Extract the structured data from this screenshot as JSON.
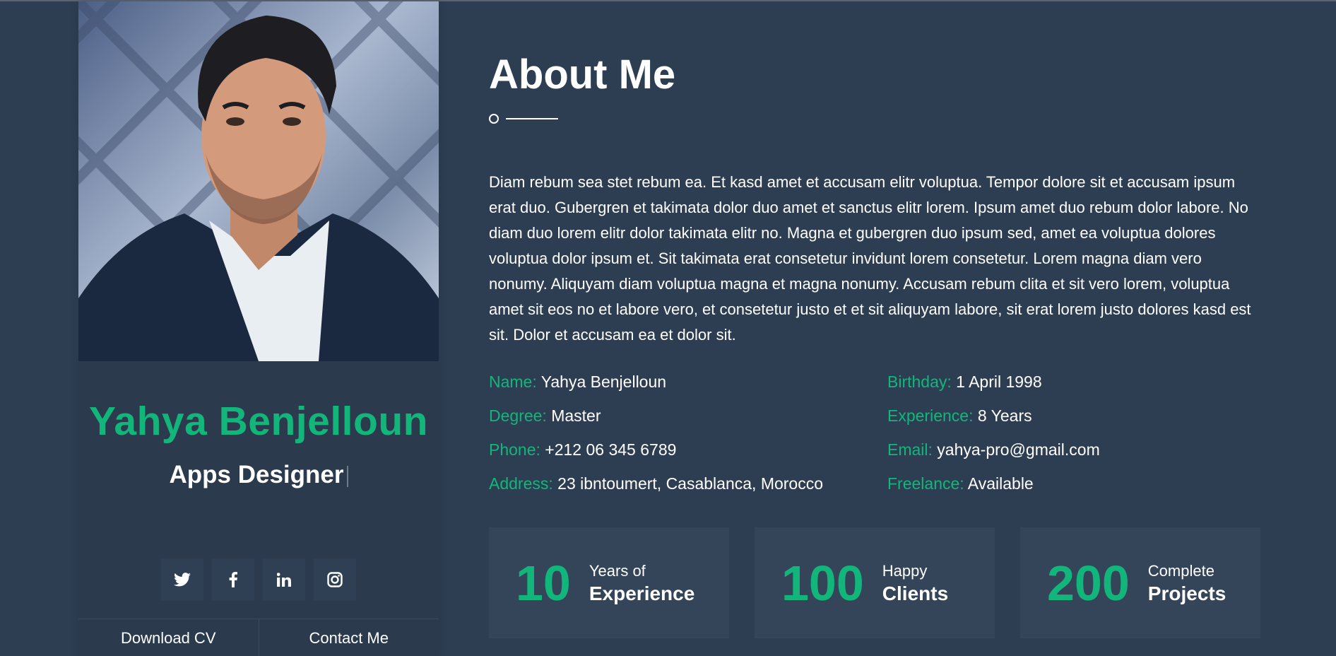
{
  "colors": {
    "background": "#2e3e52",
    "accent": "#12b67a",
    "panel": "#2b3a4d",
    "card": "#354559"
  },
  "profile": {
    "name": "Yahya Benjelloun",
    "role": "Apps Designer",
    "socials": [
      {
        "icon": "twitter-icon",
        "glyph": "🐦"
      },
      {
        "icon": "facebook-icon",
        "glyph": "f"
      },
      {
        "icon": "linkedin-icon",
        "glyph": "in"
      },
      {
        "icon": "instagram-icon",
        "glyph": "◎"
      }
    ],
    "download_cv": "Download CV",
    "contact_me": "Contact Me"
  },
  "about": {
    "title": "About Me",
    "bio": "Diam rebum sea stet rebum ea. Et kasd amet et accusam elitr voluptua. Tempor dolore sit et accusam ipsum erat duo. Gubergren et takimata dolor duo amet et sanctus elitr lorem. Ipsum amet duo rebum dolor labore. No diam duo lorem elitr dolor takimata elitr no. Magna et gubergren duo ipsum sed, amet ea voluptua dolores voluptua dolor ipsum et. Sit takimata erat consetetur invidunt lorem consetetur. Lorem magna diam vero nonumy. Aliquyam diam voluptua magna et magna nonumy. Accusam rebum clita et sit vero lorem, voluptua amet sit eos no et labore vero, et consetetur justo et et sit aliquyam labore, sit erat lorem justo dolores kasd est sit. Dolor et accusam ea et dolor sit.",
    "info": {
      "name_label": "Name:",
      "name_value": "Yahya Benjelloun",
      "birthday_label": "Birthday:",
      "birthday_value": "1 April 1998",
      "degree_label": "Degree:",
      "degree_value": "Master",
      "experience_label": "Experience:",
      "experience_value": "8 Years",
      "phone_label": "Phone:",
      "phone_value": "+212 06 345 6789",
      "email_label": "Email:",
      "email_value": "yahya-pro@gmail.com",
      "address_label": "Address:",
      "address_value": "23 ibntoumert, Casablanca, Morocco",
      "freelance_label": "Freelance:",
      "freelance_value": "Available"
    },
    "stats": [
      {
        "number": "10",
        "line1": "Years of",
        "line2": "Experience"
      },
      {
        "number": "100",
        "line1": "Happy",
        "line2": "Clients"
      },
      {
        "number": "200",
        "line1": "Complete",
        "line2": "Projects"
      }
    ]
  }
}
